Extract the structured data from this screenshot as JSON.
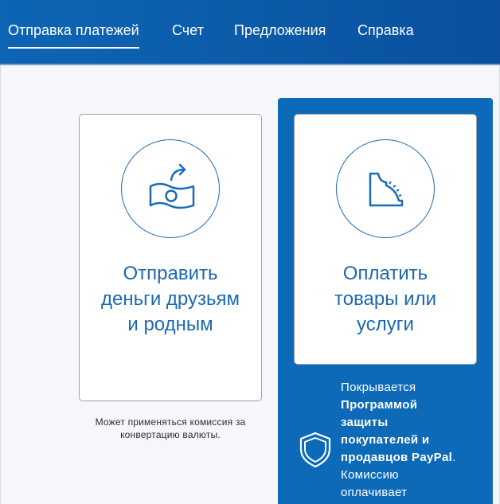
{
  "nav": {
    "items": [
      {
        "label": "Отправка платежей",
        "active": true
      },
      {
        "label": "Счет",
        "active": false
      },
      {
        "label": "Предложения",
        "active": false
      },
      {
        "label": "Справка",
        "active": false
      }
    ]
  },
  "cards": {
    "send": {
      "icon": "money-send-icon",
      "title_line1": "Отправить",
      "title_line2": "деньги друзьям",
      "title_line3": "и родным"
    },
    "pay": {
      "icon": "receipt-pay-icon",
      "title_line1": "Оплатить",
      "title_line2": "товары или",
      "title_line3": "услуги"
    }
  },
  "fee_note": {
    "line1": "Может применяться комиссия за",
    "line2": "конвертацию валюты."
  },
  "protection": {
    "icon": "shield-icon",
    "line1": "Покрывается",
    "line2_bold": "Программой",
    "line3_bold": "защиты",
    "line4_bold": "покупателей и",
    "line5_bold": "продавцов PayPal",
    "line5_tail": ".",
    "line6": "Комиссию",
    "line7": "оплачивает"
  },
  "colors": {
    "nav_bg": "#0b5aa8",
    "accent_blue": "#1c68b1",
    "panel_blue": "#0d6ab9",
    "card_border": "#9aa3ad"
  }
}
